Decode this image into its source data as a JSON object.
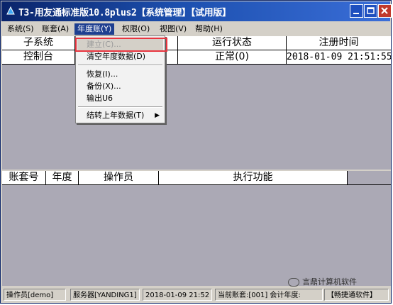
{
  "window": {
    "title": "T3-用友通标准版10.8plus2【系统管理】【试用版】"
  },
  "menubar": {
    "items": [
      "系统(S)",
      "账套(A)",
      "年度账(Y)",
      "权限(O)",
      "视图(V)",
      "帮助(H)"
    ],
    "active_index": 2
  },
  "upper_table": {
    "columns": [
      "子系统",
      "",
      "运行状态",
      "注册时间"
    ],
    "rows": [
      [
        "控制台",
        "",
        "正常(0)",
        "2018-01-09 21:51:55"
      ]
    ]
  },
  "lower_table": {
    "columns": [
      "账套号",
      "年度",
      "操作员",
      "执行功能"
    ]
  },
  "year_menu": {
    "items": [
      {
        "label": "建立(C)...",
        "disabled": true
      },
      {
        "label": "清空年度数据(D)",
        "disabled": false
      },
      {
        "label": "恢复(I)...",
        "disabled": false
      },
      {
        "label": "备份(X)...",
        "disabled": false
      },
      {
        "label": "输出U6",
        "disabled": false
      },
      {
        "label": "结转上年数据(T)",
        "disabled": false,
        "submenu": true
      }
    ]
  },
  "watermark": "言鼎计算机软件",
  "statusbar": {
    "operator": "操作员[demo]",
    "server": "服务器[YANDING1]",
    "datetime": "2018-01-09 21:52",
    "current_account": "当前账套:[001] 会计年度:",
    "product": "【畅捷通软件】"
  },
  "colors": {
    "title_bar": "#0a246a",
    "menu_active": "#1e3f90",
    "highlight_box": "#e8353f",
    "grid_background": "#aba9b5"
  }
}
